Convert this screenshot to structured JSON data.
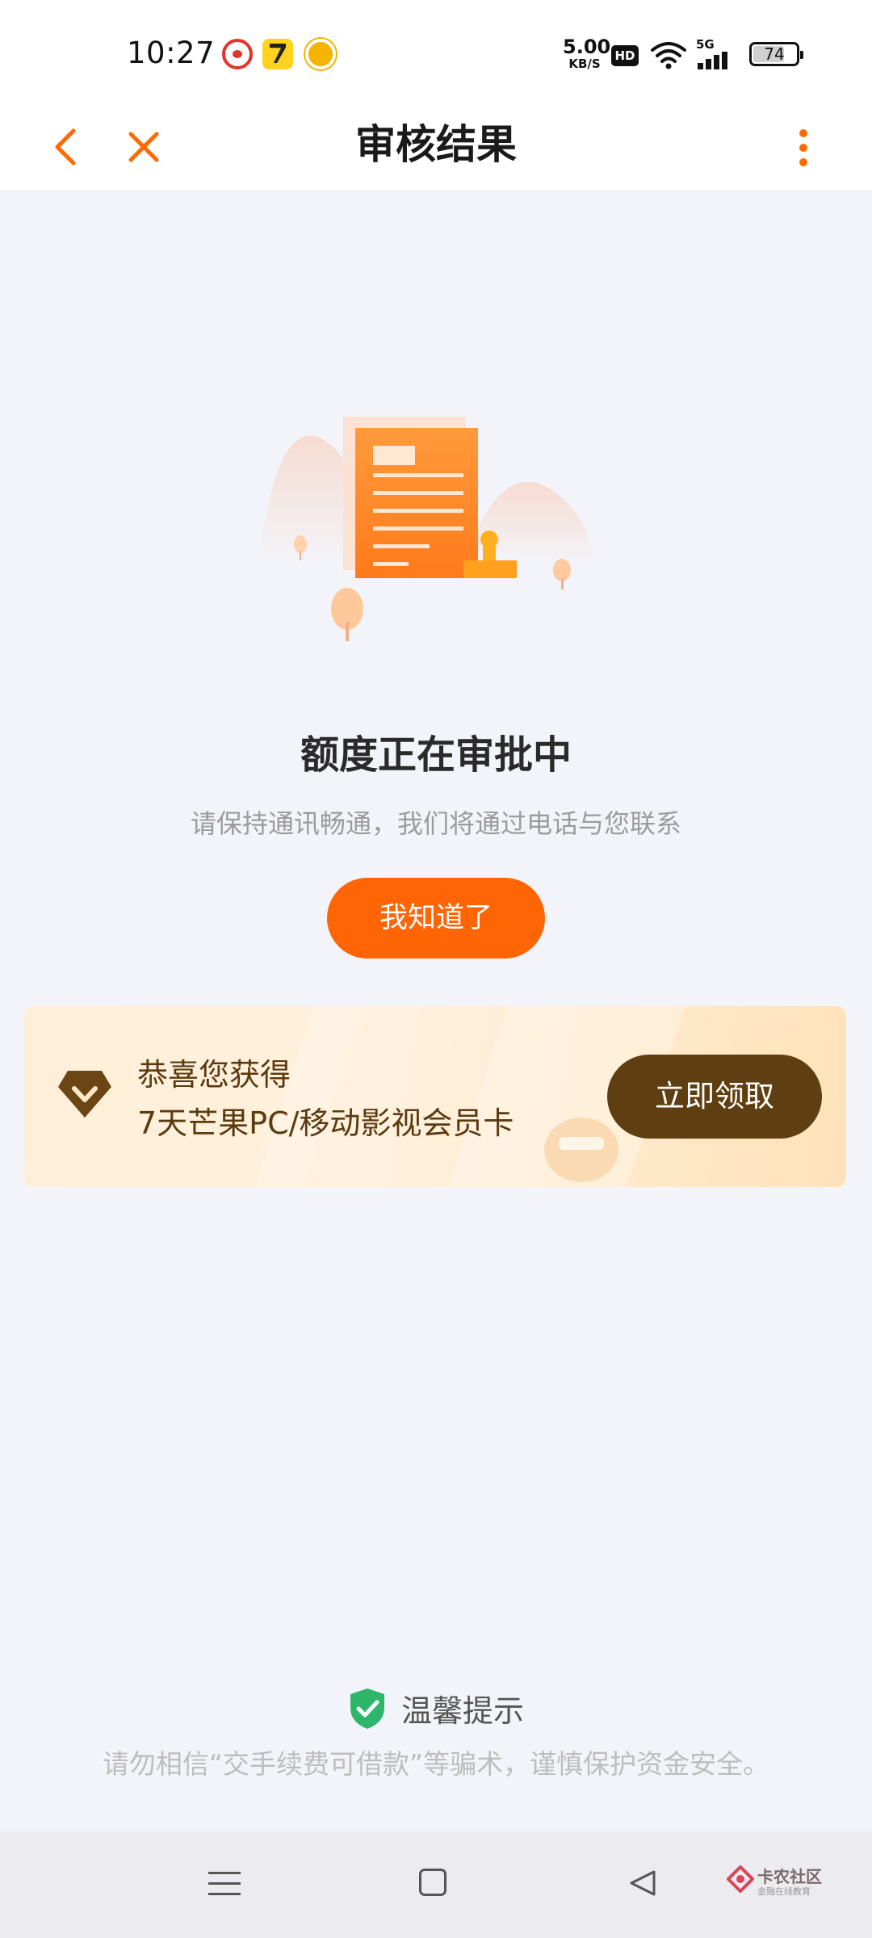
{
  "status_bar": {
    "time": "10:27",
    "net_speed_value": "5.00",
    "net_speed_unit": "KB/S",
    "hd_label": "HD",
    "network_label": "5G",
    "battery_level": "74",
    "app_icons": [
      "weibo-icon",
      "qimao-icon",
      "video-app-icon"
    ]
  },
  "nav": {
    "title": "审核结果",
    "accent_color": "#ff6a00"
  },
  "result": {
    "title": "额度正在审批中",
    "description": "请保持通讯畅通，我们将通过电话与您联系",
    "button_label": "我知道了",
    "button_color": "#ff6405"
  },
  "promo": {
    "line1": "恭喜您获得",
    "line2": "7天芒果PC/移动影视会员卡",
    "button_label": "立即领取",
    "button_color": "#5f3f12"
  },
  "tips": {
    "title": "温馨提示",
    "text": "请勿相信“交手续费可借款”等骗术，谨慎保护资金安全。",
    "shield_color": "#2db66a"
  },
  "watermark": {
    "name": "卡农社区",
    "sub": "金融在线教育"
  }
}
